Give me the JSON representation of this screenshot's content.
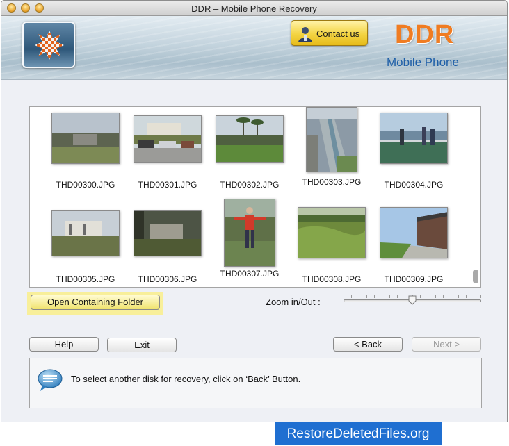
{
  "window": {
    "title": "DDR – Mobile Phone Recovery"
  },
  "header": {
    "contact_label": "Contact us",
    "brand": "DDR",
    "brand_subtitle": "Mobile Phone",
    "brand_color": "#f07c22",
    "subtitle_color": "#1f5fa8"
  },
  "thumbnails": [
    {
      "name": "THD00300.JPG"
    },
    {
      "name": "THD00301.JPG"
    },
    {
      "name": "THD00302.JPG"
    },
    {
      "name": "THD00303.JPG"
    },
    {
      "name": "THD00304.JPG"
    },
    {
      "name": "THD00305.JPG"
    },
    {
      "name": "THD00306.JPG"
    },
    {
      "name": "THD00307.JPG"
    },
    {
      "name": "THD00308.JPG"
    },
    {
      "name": "THD00309.JPG"
    }
  ],
  "controls": {
    "open_folder_label": "Open Containing Folder",
    "zoom_label": "Zoom in/Out :",
    "zoom_level": 0.5
  },
  "buttons": {
    "help": "Help",
    "exit": "Exit",
    "back": "< Back",
    "next": "Next >"
  },
  "message": {
    "text": "To select another disk for recovery, click on ‘Back’ Button."
  },
  "footer": {
    "link": "RestoreDeletedFiles.org"
  }
}
